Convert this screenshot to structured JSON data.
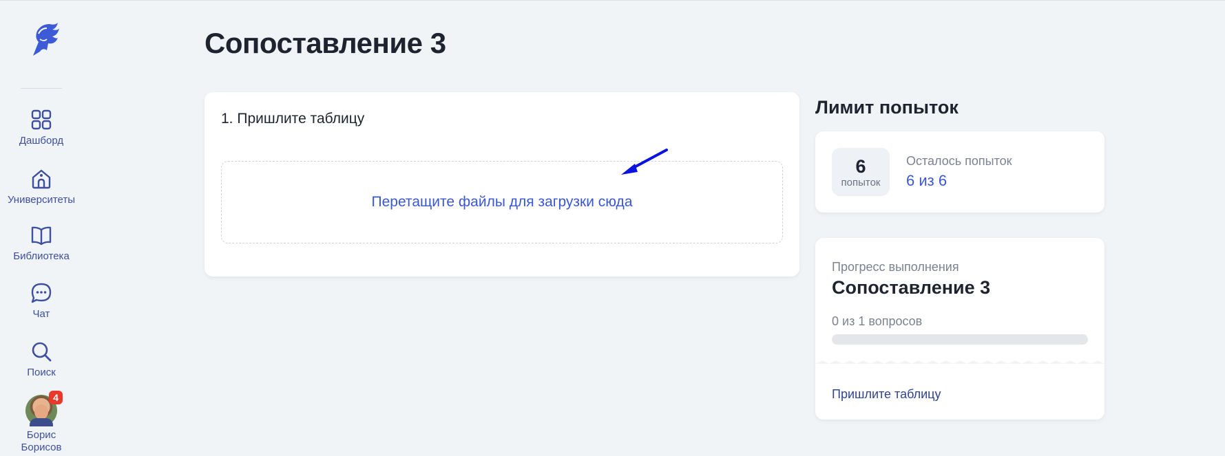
{
  "sidebar": {
    "items": [
      {
        "label": "Дашборд",
        "icon": "grid-icon"
      },
      {
        "label": "Университеты",
        "icon": "university-icon"
      },
      {
        "label": "Библиотека",
        "icon": "book-icon"
      },
      {
        "label": "Чат",
        "icon": "chat-icon"
      },
      {
        "label": "Поиск",
        "icon": "search-icon"
      }
    ],
    "user": {
      "name_first": "Борис",
      "name_last": "Борисов",
      "notifications": "4"
    }
  },
  "page": {
    "title": "Сопоставление 3"
  },
  "task": {
    "title": "1. Пришлите таблицу",
    "dropzone_text": "Перетащите файлы для загрузки сюда"
  },
  "limit": {
    "heading": "Лимит попыток",
    "count": "6",
    "count_unit": "попыток",
    "remaining_label": "Осталось попыток",
    "remaining_value": "6 из 6"
  },
  "progress": {
    "label": "Прогресс выполнения",
    "title": "Сопоставление 3",
    "count_text": "0 из 1 вопросов",
    "fraction": 0,
    "item_link": "Пришлите таблицу"
  },
  "colors": {
    "accent": "#3a57d6",
    "nav": "#3d4f9e",
    "background": "#f1f4f7",
    "badge": "#e8392b",
    "arrow": "#0a12e0"
  }
}
